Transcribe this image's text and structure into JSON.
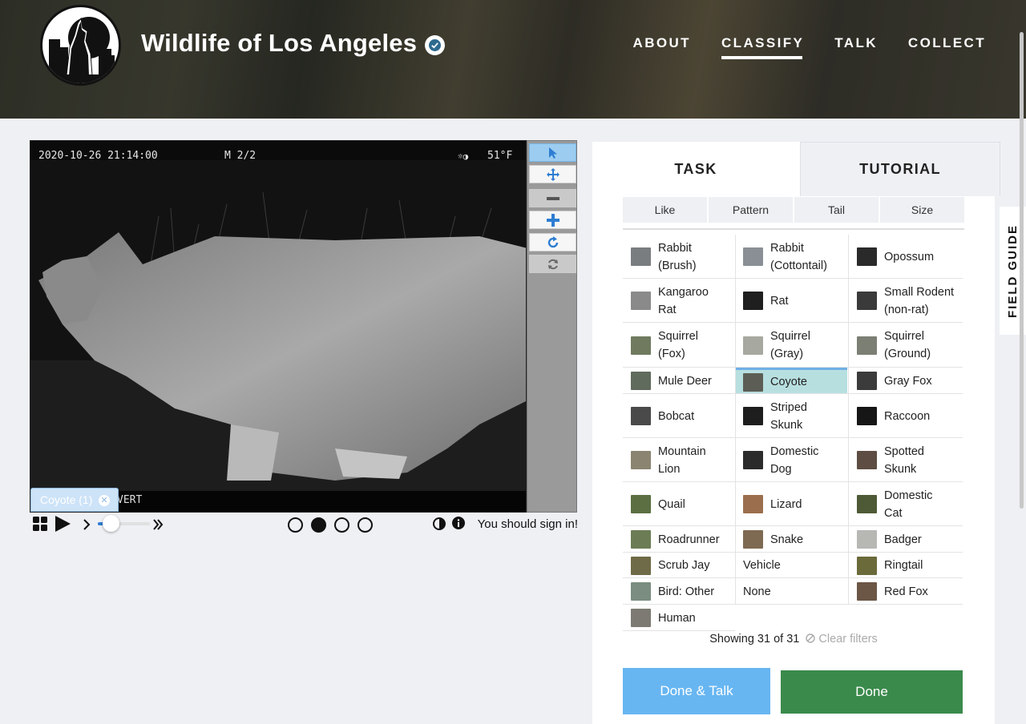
{
  "header": {
    "site_title": "Wildlife of Los Angeles",
    "nav": [
      {
        "label": "ABOUT",
        "active": false
      },
      {
        "label": "CLASSIFY",
        "active": true
      },
      {
        "label": "TALK",
        "active": false
      },
      {
        "label": "COLLECT",
        "active": false
      }
    ]
  },
  "viewer": {
    "timestamp": "2020-10-26 21:14:00",
    "frame_code": "M 2/2",
    "temperature": "51°F",
    "moon_icon": "moon-phase-icon",
    "footer_text": "VERT",
    "annotation_label": "Coyote (1)",
    "frame_dots": [
      false,
      true,
      false,
      false
    ],
    "slider_value": 0.25,
    "sign_in_text": "You should sign in!"
  },
  "tools": [
    "pointer-icon",
    "pan-icon",
    "zoom-out-icon",
    "zoom-in-icon",
    "rotate-icon",
    "reset-icon"
  ],
  "panel": {
    "tabs": [
      "TASK",
      "TUTORIAL"
    ],
    "filters": [
      "Like",
      "Pattern",
      "Tail",
      "Size"
    ],
    "species_rows": [
      [
        {
          "name": "Rabbit (Brush)",
          "line1": "Rabbit",
          "line2": "(Brush)",
          "color": "#7a7d80"
        },
        {
          "name": "Rabbit (Cottontail)",
          "line1": "Rabbit",
          "line2": "(Cottontail)",
          "color": "#8a8f96"
        },
        {
          "name": "Opossum",
          "line1": "Opossum",
          "line2": "",
          "color": "#2a2a2a"
        }
      ],
      [
        {
          "name": "Kangaroo Rat",
          "line1": "Kangaroo",
          "line2": "Rat",
          "color": "#8a8a8a"
        },
        {
          "name": "Rat",
          "line1": "Rat",
          "line2": "",
          "color": "#1f1f1f"
        },
        {
          "name": "Small Rodent (non-rat)",
          "line1": "Small Rodent",
          "line2": "(non-rat)",
          "color": "#3a3a3a"
        }
      ],
      [
        {
          "name": "Squirrel (Fox)",
          "line1": "Squirrel",
          "line2": "(Fox)",
          "color": "#6f7a5f"
        },
        {
          "name": "Squirrel (Gray)",
          "line1": "Squirrel",
          "line2": "(Gray)",
          "color": "#a7a9a0"
        },
        {
          "name": "Squirrel (Ground)",
          "line1": "Squirrel",
          "line2": "(Ground)",
          "color": "#7b7f74"
        }
      ],
      [
        {
          "name": "Mule Deer",
          "line1": "Mule Deer",
          "line2": "",
          "color": "#606a5d"
        },
        {
          "name": "Coyote",
          "line1": "Coyote",
          "line2": "",
          "color": "#5c5e55",
          "selected": true
        },
        {
          "name": "Gray Fox",
          "line1": "Gray Fox",
          "line2": "",
          "color": "#3b3b3b"
        }
      ],
      [
        {
          "name": "Bobcat",
          "line1": "Bobcat",
          "line2": "",
          "color": "#4a4a4a"
        },
        {
          "name": "Striped Skunk",
          "line1": "Striped",
          "line2": "Skunk",
          "color": "#1e1e1e"
        },
        {
          "name": "Raccoon",
          "line1": "Raccoon",
          "line2": "",
          "color": "#161616"
        }
      ],
      [
        {
          "name": "Mountain Lion",
          "line1": "Mountain",
          "line2": "Lion",
          "color": "#8b8470"
        },
        {
          "name": "Domestic Dog",
          "line1": "Domestic",
          "line2": "Dog",
          "color": "#2b2b2b"
        },
        {
          "name": "Spotted Skunk",
          "line1": "Spotted",
          "line2": "Skunk",
          "color": "#5d4d43"
        }
      ],
      [
        {
          "name": "Quail",
          "line1": "Quail",
          "line2": "",
          "color": "#5b6f42"
        },
        {
          "name": "Lizard",
          "line1": "Lizard",
          "line2": "",
          "color": "#9b6f4d"
        },
        {
          "name": "Domestic Cat",
          "line1": "Domestic",
          "line2": "Cat",
          "color": "#4e5a36"
        }
      ],
      [
        {
          "name": "Roadrunner",
          "line1": "Roadrunner",
          "line2": "",
          "color": "#6c7d55"
        },
        {
          "name": "Snake",
          "line1": "Snake",
          "line2": "",
          "color": "#7e6a52"
        },
        {
          "name": "Badger",
          "line1": "Badger",
          "line2": "",
          "color": "#b7b7b4"
        }
      ],
      [
        {
          "name": "Scrub Jay",
          "line1": "Scrub Jay",
          "line2": "",
          "color": "#6f6a47"
        },
        {
          "name": "Vehicle",
          "line1": "Vehicle",
          "line2": "",
          "color": ""
        },
        {
          "name": "Ringtail",
          "line1": "Ringtail",
          "line2": "",
          "color": "#6b6a3a"
        }
      ],
      [
        {
          "name": "Bird: Other",
          "line1": "Bird: Other",
          "line2": "",
          "color": "#7a8d80"
        },
        {
          "name": "None",
          "line1": "None",
          "line2": "",
          "color": ""
        },
        {
          "name": "Red Fox",
          "line1": "Red Fox",
          "line2": "",
          "color": "#6c5646"
        }
      ],
      [
        {
          "name": "Human",
          "line1": "Human",
          "line2": "",
          "color": "#7c7a72"
        }
      ]
    ],
    "showing_text": "Showing 31 of 31",
    "clear_filters": "Clear filters",
    "done_talk_label": "Done & Talk",
    "done_label": "Done"
  },
  "field_guide_label": "FIELD GUIDE",
  "colors": {
    "accent_blue": "#67b6f2",
    "done_green": "#3a8a4b",
    "selected_teal": "#b8dfe0",
    "page_bg": "#eef0f4"
  }
}
